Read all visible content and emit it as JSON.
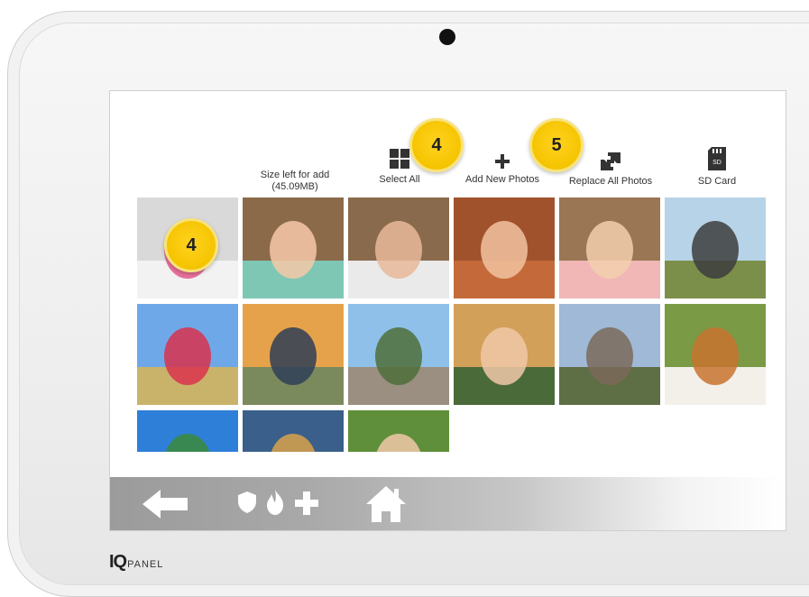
{
  "toolbar": {
    "size_left_label": "Size left for add (45.09MB)",
    "select_all_label": "Select All",
    "add_new_label": "Add New Photos",
    "replace_all_label": "Replace All Photos",
    "sd_card_label": "SD Card"
  },
  "callouts": {
    "photo_callout": "4",
    "select_all_callout": "4",
    "add_new_callout": "5"
  },
  "photos": [
    {
      "name": "family-portrait",
      "sky": "#d9d9d9",
      "ground": "#f2f2f2",
      "accent": "#e85a8c"
    },
    {
      "name": "girl-pink-bow",
      "sky": "#8b6a4a",
      "ground": "#7fc7b5",
      "accent": "#f6c8a8"
    },
    {
      "name": "boy-wood-background",
      "sky": "#8a6a4c",
      "ground": "#eaeaea",
      "accent": "#e8b89a"
    },
    {
      "name": "girl-smiling-closeup",
      "sky": "#a0522d",
      "ground": "#c46a3a",
      "accent": "#f2c2a0"
    },
    {
      "name": "blonde-girl-closeup",
      "sky": "#9a7654",
      "ground": "#f1b7b7",
      "accent": "#f3cfae"
    },
    {
      "name": "mountain-bikers",
      "sky": "#b7d3e8",
      "ground": "#7c8f4a",
      "accent": "#3d3d3d"
    },
    {
      "name": "girl-mountain-meadow",
      "sky": "#6fa8e8",
      "ground": "#c9b36a",
      "accent": "#d9334c"
    },
    {
      "name": "three-kids-autumn",
      "sky": "#e6a24a",
      "ground": "#7b8a5c",
      "accent": "#2f3e57"
    },
    {
      "name": "family-road-walk",
      "sky": "#8fc0ea",
      "ground": "#9a8f80",
      "accent": "#4f6e3a"
    },
    {
      "name": "boy-girl-hug",
      "sky": "#d3a05a",
      "ground": "#4b6a3a",
      "accent": "#f0c8a8"
    },
    {
      "name": "valley-village",
      "sky": "#9fb9d6",
      "ground": "#5e6e45",
      "accent": "#7a6a5a"
    },
    {
      "name": "spaniel-dog",
      "sky": "#7a9a45",
      "ground": "#f3f0ea",
      "accent": "#c8732e"
    },
    {
      "name": "palm-trees",
      "sky": "#2e7fd8",
      "ground": "#f2e0a8",
      "accent": "#3b8a3a"
    },
    {
      "name": "mountain-lake",
      "sky": "#3a5f8a",
      "ground": "#1f2e3a",
      "accent": "#d8a24a"
    },
    {
      "name": "elderly-couple",
      "sky": "#5f8f3a",
      "ground": "#cfcfcf",
      "accent": "#f0c8a8"
    }
  ],
  "colors": {
    "callout_fill": "#f5c400",
    "navbar_start": "#9b9b9b"
  },
  "nav": {
    "back_icon": "back-arrow-icon",
    "security_icons": [
      "shield-icon",
      "fire-icon",
      "medical-plus-icon"
    ],
    "home_icon": "home-icon"
  },
  "brand": {
    "logo_iq": "IQ",
    "logo_panel": "PANEL"
  }
}
